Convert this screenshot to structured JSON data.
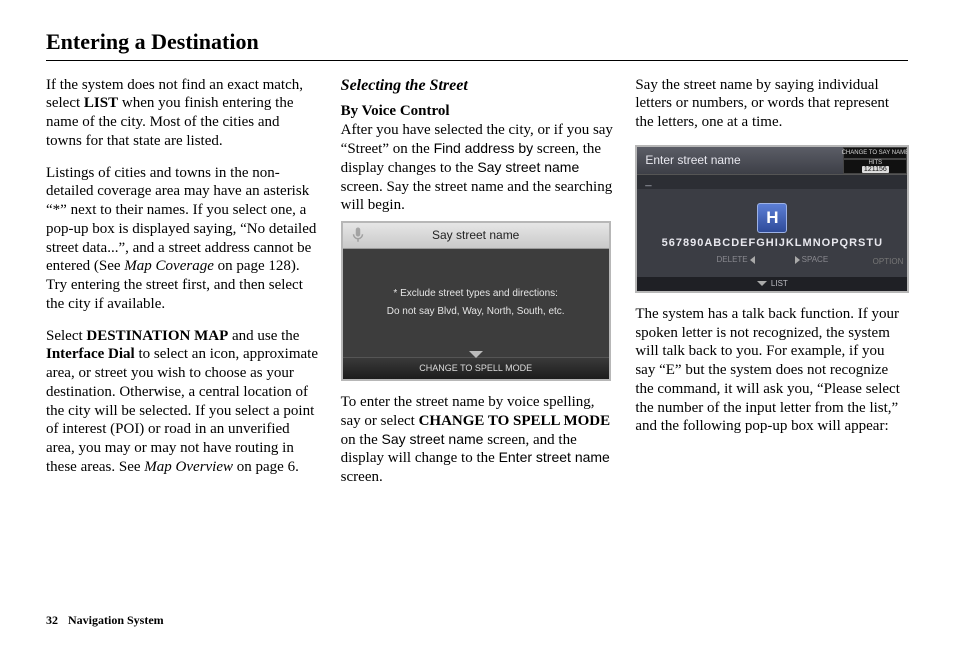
{
  "title": "Entering a Destination",
  "footer": {
    "page": "32",
    "label": "Navigation System"
  },
  "col1": {
    "p1a": "If the system does not find an exact match, select ",
    "p1b": "LIST",
    "p1c": " when you finish entering the name of the city. Most of the cities and towns for that state are listed.",
    "p2a": "Listings of cities and towns in the non-detailed coverage area may have an asterisk “*” next to their names. If you select one, a pop-up box is displayed saying, “No detailed street data...”, and a street address cannot be entered (See ",
    "p2b": "Map Coverage",
    "p2c": " on page 128). Try entering the street first, and then select the city if available.",
    "p3a": "Select ",
    "p3b": "DESTINATION MAP",
    "p3c": " and use the ",
    "p3d": "Interface Dial",
    "p3e": " to select an icon, approximate area, or street you wish to choose as your destination. Otherwise, a central location of the city will be selected. If you select a point of interest (POI) or road in an unverified area, you may or may not have routing in these areas. See ",
    "p3f": "Map Overview",
    "p3g": " on page 6."
  },
  "col2": {
    "section": "Selecting the Street",
    "sub": "By Voice Control",
    "p1a": "After you have selected the city, or if you say “Street” on the ",
    "p1b": "Find address by",
    "p1c": " screen, the display changes to the ",
    "p1d": "Say street name",
    "p1e": " screen. Say the street name and the searching will begin.",
    "shot1": {
      "title": "Say street name",
      "line1": "* Exclude street types and directions:",
      "line2": "Do not say Blvd, Way, North, South, etc.",
      "foot": "CHANGE TO SPELL MODE"
    },
    "p2a": "To enter the street name by voice spelling, say or select ",
    "p2b": "CHANGE TO SPELL MODE",
    "p2c": " on the ",
    "p2d": "Say street name",
    "p2e": " screen, and the display will change to the ",
    "p2f": "Enter street name",
    "p2g": " screen."
  },
  "col3": {
    "p1": "Say the street name by saying individual letters or numbers, or words that represent the letters, one at a time.",
    "shot2": {
      "title": "Enter street name",
      "change": "CHANGE TO SAY NAME",
      "hits_label": "HITS",
      "hits_value": "121156",
      "cursor": "_",
      "highlight": "H",
      "row": "567890ABCDEFGHIJKLMNOPQRSTU",
      "delete": "DELETE",
      "space": "SPACE",
      "option": "OPTION",
      "list": "LIST"
    },
    "p2": "The system has a talk back function. If your spoken letter is not recognized, the system will talk back to you. For example, if you say “E” but the system does not recognize the command, it will ask you, “Please select the number of the input letter from the list,” and the following pop-up box will appear:"
  }
}
